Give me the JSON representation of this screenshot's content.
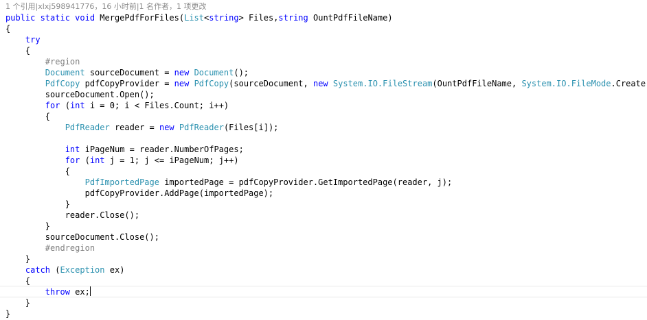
{
  "codelens": "1 个引用|xlxj598941776，16 小时前|1 名作者，1 项更改",
  "lines": [
    [
      {
        "t": "public static void ",
        "c": "kw"
      },
      {
        "t": "MergePdfForFiles(",
        "c": ""
      },
      {
        "t": "List",
        "c": "ty"
      },
      {
        "t": "<",
        "c": ""
      },
      {
        "t": "string",
        "c": "kw"
      },
      {
        "t": "> Files,",
        "c": ""
      },
      {
        "t": "string",
        "c": "kw"
      },
      {
        "t": " OuntPdfFileName)",
        "c": ""
      }
    ],
    [
      {
        "t": "{",
        "c": ""
      }
    ],
    [
      {
        "t": "    ",
        "c": ""
      },
      {
        "t": "try",
        "c": "kw"
      }
    ],
    [
      {
        "t": "    {",
        "c": ""
      }
    ],
    [
      {
        "t": "        #region",
        "c": "cm"
      }
    ],
    [
      {
        "t": "        ",
        "c": ""
      },
      {
        "t": "Document",
        "c": "ty"
      },
      {
        "t": " sourceDocument = ",
        "c": ""
      },
      {
        "t": "new",
        "c": "kw"
      },
      {
        "t": " ",
        "c": ""
      },
      {
        "t": "Document",
        "c": "ty"
      },
      {
        "t": "();",
        "c": ""
      }
    ],
    [
      {
        "t": "        ",
        "c": ""
      },
      {
        "t": "PdfCopy",
        "c": "ty"
      },
      {
        "t": " pdfCopyProvider = ",
        "c": ""
      },
      {
        "t": "new",
        "c": "kw"
      },
      {
        "t": " ",
        "c": ""
      },
      {
        "t": "PdfCopy",
        "c": "ty"
      },
      {
        "t": "(sourceDocument, ",
        "c": ""
      },
      {
        "t": "new",
        "c": "kw"
      },
      {
        "t": " ",
        "c": ""
      },
      {
        "t": "System.IO.",
        "c": "ty"
      },
      {
        "t": "FileStream",
        "c": "ty"
      },
      {
        "t": "(OuntPdfFileName, ",
        "c": ""
      },
      {
        "t": "System.IO.",
        "c": "ty"
      },
      {
        "t": "FileMode",
        "c": "ty"
      },
      {
        "t": ".Create));",
        "c": ""
      }
    ],
    [
      {
        "t": "        sourceDocument.Open();",
        "c": ""
      }
    ],
    [
      {
        "t": "        ",
        "c": ""
      },
      {
        "t": "for",
        "c": "kw"
      },
      {
        "t": " (",
        "c": ""
      },
      {
        "t": "int",
        "c": "kw"
      },
      {
        "t": " i = 0; i < Files.Count; i++)",
        "c": ""
      }
    ],
    [
      {
        "t": "        {",
        "c": ""
      }
    ],
    [
      {
        "t": "            ",
        "c": ""
      },
      {
        "t": "PdfReader",
        "c": "ty"
      },
      {
        "t": " reader = ",
        "c": ""
      },
      {
        "t": "new",
        "c": "kw"
      },
      {
        "t": " ",
        "c": ""
      },
      {
        "t": "PdfReader",
        "c": "ty"
      },
      {
        "t": "(Files[i]);",
        "c": ""
      }
    ],
    [
      {
        "t": "",
        "c": ""
      }
    ],
    [
      {
        "t": "            ",
        "c": ""
      },
      {
        "t": "int",
        "c": "kw"
      },
      {
        "t": " iPageNum = reader.NumberOfPages;",
        "c": ""
      }
    ],
    [
      {
        "t": "            ",
        "c": ""
      },
      {
        "t": "for",
        "c": "kw"
      },
      {
        "t": " (",
        "c": ""
      },
      {
        "t": "int",
        "c": "kw"
      },
      {
        "t": " j = 1; j <= iPageNum; j++)",
        "c": ""
      }
    ],
    [
      {
        "t": "            {",
        "c": ""
      }
    ],
    [
      {
        "t": "                ",
        "c": ""
      },
      {
        "t": "PdfImportedPage",
        "c": "ty"
      },
      {
        "t": " importedPage = pdfCopyProvider.GetImportedPage(reader, j);",
        "c": ""
      }
    ],
    [
      {
        "t": "                pdfCopyProvider.AddPage(importedPage);",
        "c": ""
      }
    ],
    [
      {
        "t": "            }",
        "c": ""
      }
    ],
    [
      {
        "t": "            reader.Close();",
        "c": ""
      }
    ],
    [
      {
        "t": "        }",
        "c": ""
      }
    ],
    [
      {
        "t": "        sourceDocument.Close();",
        "c": ""
      }
    ],
    [
      {
        "t": "        #endregion",
        "c": "cm"
      }
    ],
    [
      {
        "t": "    }",
        "c": ""
      }
    ],
    [
      {
        "t": "    ",
        "c": ""
      },
      {
        "t": "catch",
        "c": "kw"
      },
      {
        "t": " (",
        "c": ""
      },
      {
        "t": "Exception",
        "c": "ty"
      },
      {
        "t": " ex)",
        "c": ""
      }
    ],
    [
      {
        "t": "    {",
        "c": ""
      }
    ],
    [
      {
        "t": "        ",
        "c": ""
      },
      {
        "t": "throw",
        "c": "kw"
      },
      {
        "t": " ex;",
        "c": ""
      }
    ],
    [
      {
        "t": "    }",
        "c": ""
      }
    ],
    [
      {
        "t": "}",
        "c": ""
      }
    ]
  ],
  "current_line": 25,
  "colors": {
    "keyword": "#0000ff",
    "type": "#2b91af",
    "comment": "#808080",
    "text": "#000000",
    "codelens": "#8a8a8a"
  }
}
